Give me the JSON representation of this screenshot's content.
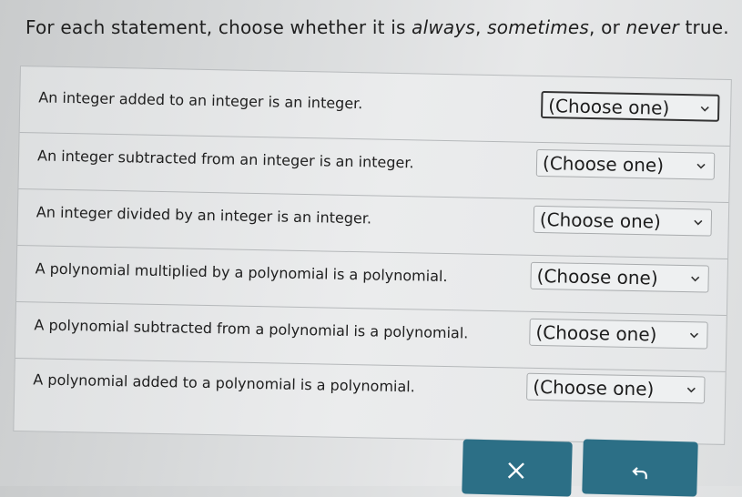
{
  "instructions": {
    "prefix": "For each statement, choose whether it is ",
    "always": "always",
    "sep1": ", ",
    "sometimes": "sometimes",
    "sep2": ", or ",
    "never": "never",
    "suffix": " true."
  },
  "statements": [
    {
      "text": "An integer added to an integer is an integer.",
      "selected": "(Choose one)"
    },
    {
      "text": "An integer subtracted from an integer is an integer.",
      "selected": "(Choose one)"
    },
    {
      "text": "An integer divided by an integer is an integer.",
      "selected": "(Choose one)"
    },
    {
      "text": "A polynomial multiplied by a polynomial is a polynomial.",
      "selected": "(Choose one)"
    },
    {
      "text": "A polynomial subtracted from a polynomial is a polynomial.",
      "selected": "(Choose one)"
    },
    {
      "text": "A polynomial added to a polynomial is a polynomial.",
      "selected": "(Choose one)"
    }
  ],
  "buttons": {
    "clear_icon": "close-icon",
    "undo_icon": "undo-icon",
    "color": "#2c6f86"
  }
}
